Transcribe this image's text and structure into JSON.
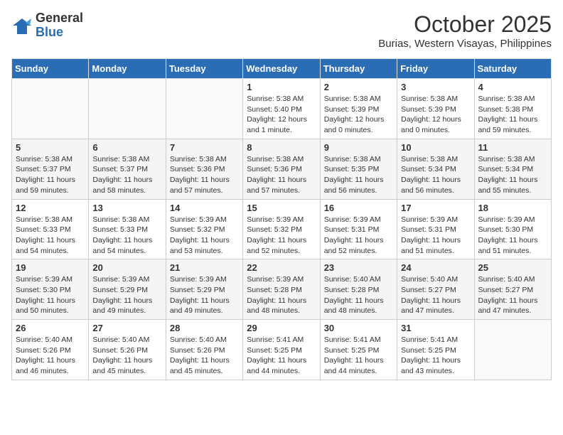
{
  "header": {
    "logo_line1": "General",
    "logo_line2": "Blue",
    "month": "October 2025",
    "location": "Burias, Western Visayas, Philippines"
  },
  "weekdays": [
    "Sunday",
    "Monday",
    "Tuesday",
    "Wednesday",
    "Thursday",
    "Friday",
    "Saturday"
  ],
  "weeks": [
    [
      {
        "day": "",
        "info": ""
      },
      {
        "day": "",
        "info": ""
      },
      {
        "day": "",
        "info": ""
      },
      {
        "day": "1",
        "info": "Sunrise: 5:38 AM\nSunset: 5:40 PM\nDaylight: 12 hours\nand 1 minute."
      },
      {
        "day": "2",
        "info": "Sunrise: 5:38 AM\nSunset: 5:39 PM\nDaylight: 12 hours\nand 0 minutes."
      },
      {
        "day": "3",
        "info": "Sunrise: 5:38 AM\nSunset: 5:39 PM\nDaylight: 12 hours\nand 0 minutes."
      },
      {
        "day": "4",
        "info": "Sunrise: 5:38 AM\nSunset: 5:38 PM\nDaylight: 11 hours\nand 59 minutes."
      }
    ],
    [
      {
        "day": "5",
        "info": "Sunrise: 5:38 AM\nSunset: 5:37 PM\nDaylight: 11 hours\nand 59 minutes."
      },
      {
        "day": "6",
        "info": "Sunrise: 5:38 AM\nSunset: 5:37 PM\nDaylight: 11 hours\nand 58 minutes."
      },
      {
        "day": "7",
        "info": "Sunrise: 5:38 AM\nSunset: 5:36 PM\nDaylight: 11 hours\nand 57 minutes."
      },
      {
        "day": "8",
        "info": "Sunrise: 5:38 AM\nSunset: 5:36 PM\nDaylight: 11 hours\nand 57 minutes."
      },
      {
        "day": "9",
        "info": "Sunrise: 5:38 AM\nSunset: 5:35 PM\nDaylight: 11 hours\nand 56 minutes."
      },
      {
        "day": "10",
        "info": "Sunrise: 5:38 AM\nSunset: 5:34 PM\nDaylight: 11 hours\nand 56 minutes."
      },
      {
        "day": "11",
        "info": "Sunrise: 5:38 AM\nSunset: 5:34 PM\nDaylight: 11 hours\nand 55 minutes."
      }
    ],
    [
      {
        "day": "12",
        "info": "Sunrise: 5:38 AM\nSunset: 5:33 PM\nDaylight: 11 hours\nand 54 minutes."
      },
      {
        "day": "13",
        "info": "Sunrise: 5:38 AM\nSunset: 5:33 PM\nDaylight: 11 hours\nand 54 minutes."
      },
      {
        "day": "14",
        "info": "Sunrise: 5:39 AM\nSunset: 5:32 PM\nDaylight: 11 hours\nand 53 minutes."
      },
      {
        "day": "15",
        "info": "Sunrise: 5:39 AM\nSunset: 5:32 PM\nDaylight: 11 hours\nand 52 minutes."
      },
      {
        "day": "16",
        "info": "Sunrise: 5:39 AM\nSunset: 5:31 PM\nDaylight: 11 hours\nand 52 minutes."
      },
      {
        "day": "17",
        "info": "Sunrise: 5:39 AM\nSunset: 5:31 PM\nDaylight: 11 hours\nand 51 minutes."
      },
      {
        "day": "18",
        "info": "Sunrise: 5:39 AM\nSunset: 5:30 PM\nDaylight: 11 hours\nand 51 minutes."
      }
    ],
    [
      {
        "day": "19",
        "info": "Sunrise: 5:39 AM\nSunset: 5:30 PM\nDaylight: 11 hours\nand 50 minutes."
      },
      {
        "day": "20",
        "info": "Sunrise: 5:39 AM\nSunset: 5:29 PM\nDaylight: 11 hours\nand 49 minutes."
      },
      {
        "day": "21",
        "info": "Sunrise: 5:39 AM\nSunset: 5:29 PM\nDaylight: 11 hours\nand 49 minutes."
      },
      {
        "day": "22",
        "info": "Sunrise: 5:39 AM\nSunset: 5:28 PM\nDaylight: 11 hours\nand 48 minutes."
      },
      {
        "day": "23",
        "info": "Sunrise: 5:40 AM\nSunset: 5:28 PM\nDaylight: 11 hours\nand 48 minutes."
      },
      {
        "day": "24",
        "info": "Sunrise: 5:40 AM\nSunset: 5:27 PM\nDaylight: 11 hours\nand 47 minutes."
      },
      {
        "day": "25",
        "info": "Sunrise: 5:40 AM\nSunset: 5:27 PM\nDaylight: 11 hours\nand 47 minutes."
      }
    ],
    [
      {
        "day": "26",
        "info": "Sunrise: 5:40 AM\nSunset: 5:26 PM\nDaylight: 11 hours\nand 46 minutes."
      },
      {
        "day": "27",
        "info": "Sunrise: 5:40 AM\nSunset: 5:26 PM\nDaylight: 11 hours\nand 45 minutes."
      },
      {
        "day": "28",
        "info": "Sunrise: 5:40 AM\nSunset: 5:26 PM\nDaylight: 11 hours\nand 45 minutes."
      },
      {
        "day": "29",
        "info": "Sunrise: 5:41 AM\nSunset: 5:25 PM\nDaylight: 11 hours\nand 44 minutes."
      },
      {
        "day": "30",
        "info": "Sunrise: 5:41 AM\nSunset: 5:25 PM\nDaylight: 11 hours\nand 44 minutes."
      },
      {
        "day": "31",
        "info": "Sunrise: 5:41 AM\nSunset: 5:25 PM\nDaylight: 11 hours\nand 43 minutes."
      },
      {
        "day": "",
        "info": ""
      }
    ]
  ]
}
